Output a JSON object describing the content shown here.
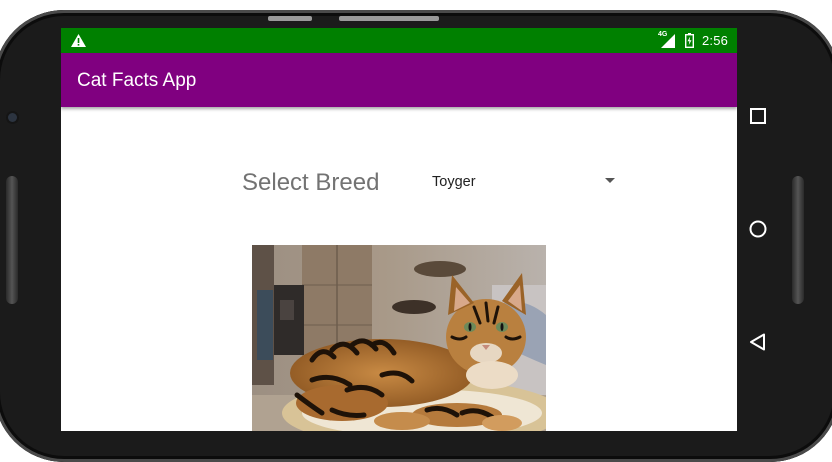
{
  "status_bar": {
    "time": "2:56",
    "network_label": "4G",
    "icons": [
      "warning-icon",
      "signal-icon",
      "battery-charging-icon"
    ],
    "color": "#008000"
  },
  "app_bar": {
    "title": "Cat Facts App",
    "color": "#800080"
  },
  "breed_selector": {
    "label": "Select Breed",
    "selected": "Toyger"
  },
  "cat_image": {
    "description_icon": "cat-photo"
  },
  "nav_bar": {
    "icons": [
      "recents-square-icon",
      "home-circle-icon",
      "back-triangle-icon"
    ]
  }
}
